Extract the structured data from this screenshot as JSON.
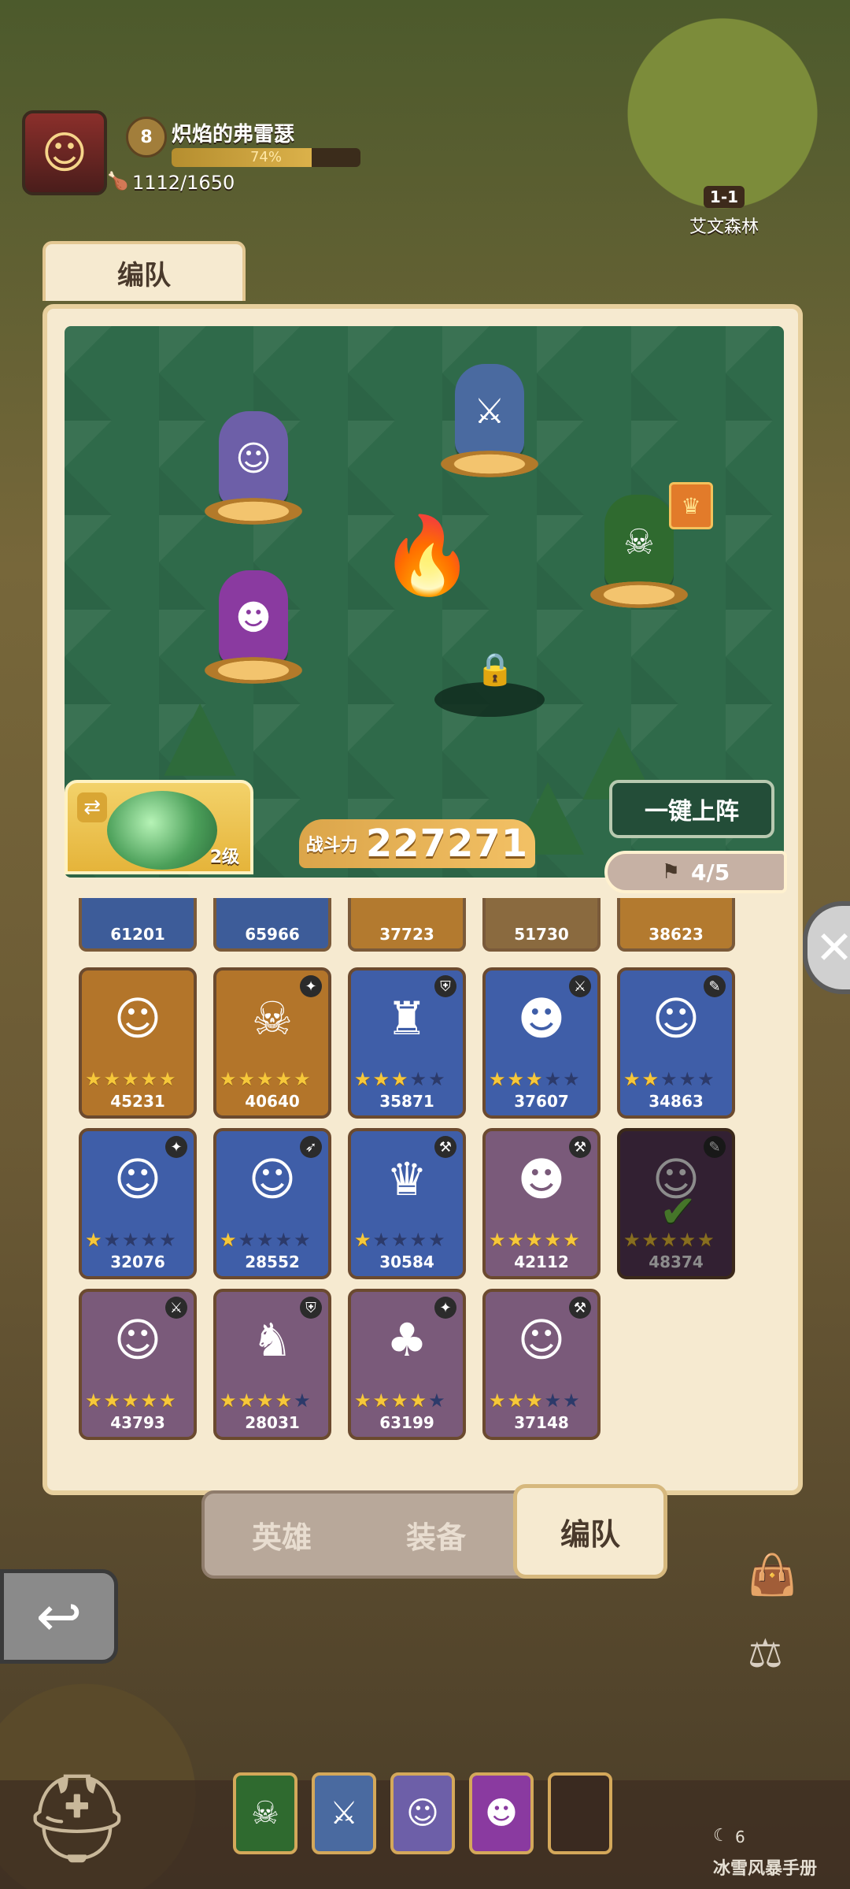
{
  "player": {
    "level": "8",
    "name": "炽焰的弗雷瑟",
    "exp_percent_text": "74%",
    "exp_fraction": 0.74,
    "stamina": "1112/1650"
  },
  "stage": {
    "code": "1-1",
    "name": "艾文森林"
  },
  "panel": {
    "title": "编队",
    "deploy_button": "一键上阵",
    "artifact_level": "2级",
    "power_label": "战斗力",
    "power_value": "227271",
    "formation_count": "4/5"
  },
  "partial_row": [
    {
      "power": "61201",
      "color": "#3d5c99"
    },
    {
      "power": "65966",
      "color": "#3d5c99"
    },
    {
      "power": "37723",
      "color": "#b37a2f"
    },
    {
      "power": "51730",
      "color": "#8a6a3f"
    },
    {
      "power": "38623",
      "color": "#b37a2f"
    }
  ],
  "heroes": [
    {
      "power": "45231",
      "stars": 5,
      "color": "#b3752a",
      "glyph": "☺",
      "class_icon": "",
      "selected": false
    },
    {
      "power": "40640",
      "stars": 5,
      "color": "#b3752a",
      "glyph": "☠",
      "class_icon": "✦",
      "selected": false
    },
    {
      "power": "35871",
      "stars": 3,
      "color": "#3f5ea8",
      "glyph": "♜",
      "class_icon": "⛨",
      "selected": false
    },
    {
      "power": "37607",
      "stars": 3,
      "color": "#3f5ea8",
      "glyph": "☻",
      "class_icon": "⚔",
      "selected": false
    },
    {
      "power": "34863",
      "stars": 2,
      "color": "#3f5ea8",
      "glyph": "☺",
      "class_icon": "✎",
      "selected": false
    },
    {
      "power": "32076",
      "stars": 1,
      "color": "#3f5ea8",
      "glyph": "☺",
      "class_icon": "✦",
      "selected": false
    },
    {
      "power": "28552",
      "stars": 1,
      "color": "#3f5ea8",
      "glyph": "☺",
      "class_icon": "➶",
      "selected": false
    },
    {
      "power": "30584",
      "stars": 1,
      "color": "#3f5ea8",
      "glyph": "♛",
      "class_icon": "⚒",
      "selected": false
    },
    {
      "power": "42112",
      "stars": 5,
      "color": "#7a5a7a",
      "glyph": "☻",
      "class_icon": "⚒",
      "selected": false
    },
    {
      "power": "48374",
      "stars": 5,
      "color": "#5a3a5a",
      "glyph": "☺",
      "class_icon": "✎",
      "selected": true
    },
    {
      "power": "43793",
      "stars": 5,
      "color": "#7a5a7a",
      "glyph": "☺",
      "class_icon": "⚔",
      "selected": false
    },
    {
      "power": "28031",
      "stars": 4,
      "color": "#7a5a7a",
      "glyph": "♞",
      "class_icon": "⛨",
      "selected": false
    },
    {
      "power": "63199",
      "stars": 4,
      "color": "#7a5a7a",
      "glyph": "♣",
      "class_icon": "✦",
      "selected": false
    },
    {
      "power": "37148",
      "stars": 3,
      "color": "#7a5a7a",
      "glyph": "☺",
      "class_icon": "⚒",
      "selected": false
    }
  ],
  "tabs": [
    {
      "label": "英雄",
      "active": false
    },
    {
      "label": "装备",
      "active": false
    },
    {
      "label": "编队",
      "active": true
    }
  ],
  "bottom": {
    "manual_label": "冰雪风暴手册",
    "moon_count": "6"
  }
}
